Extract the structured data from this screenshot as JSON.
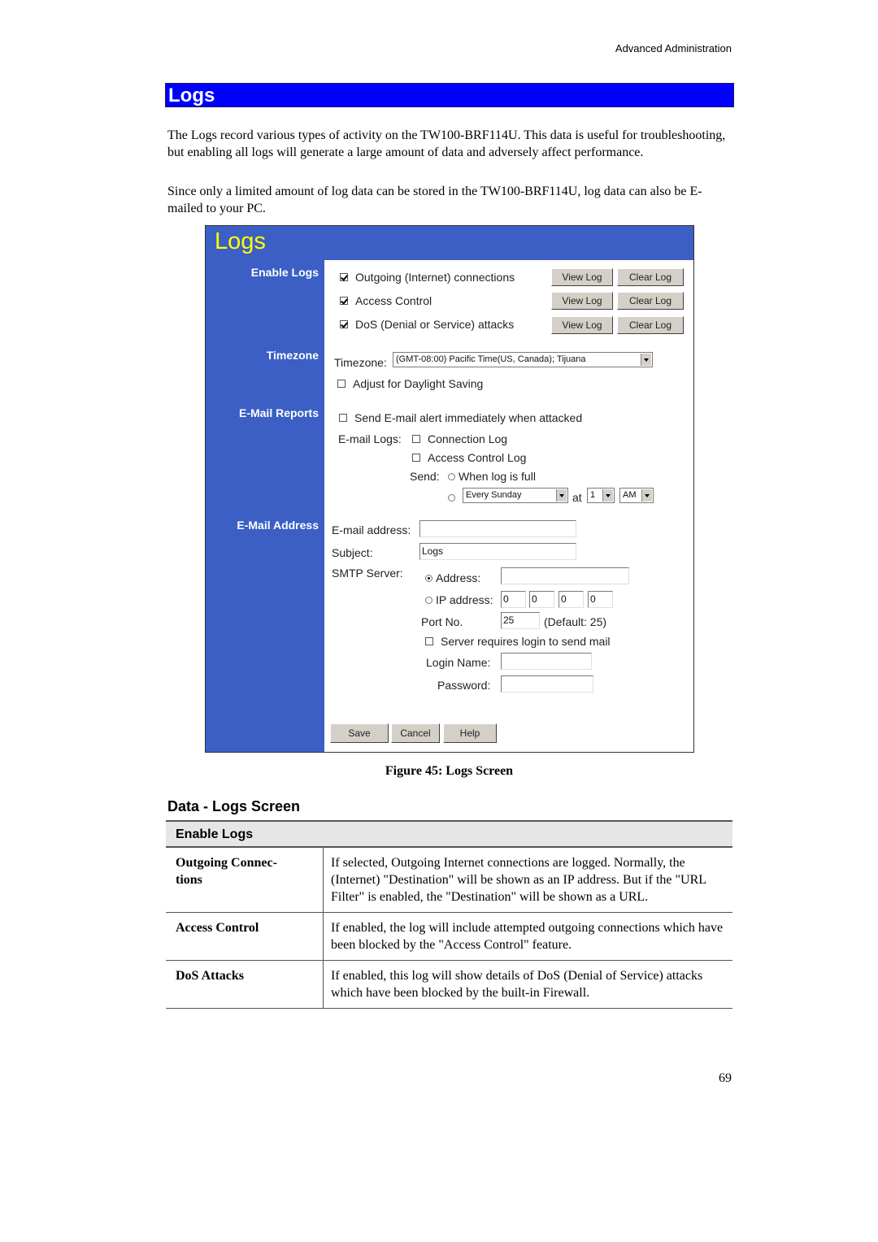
{
  "header": {
    "running_title": "Advanced Administration"
  },
  "section": {
    "title": "Logs"
  },
  "intro": {
    "paragraph1": "The Logs record various types of activity on the TW100-BRF114U. This data is useful for troubleshooting, but enabling all logs will generate a large amount of data and adversely affect performance.",
    "paragraph2": "Since only a limited amount of log data can be stored in the TW100-BRF114U, log data can also be E-mailed to your PC."
  },
  "figure": {
    "title": "Logs",
    "colors": {
      "sidebar": "#3b5fc4",
      "title": "#ffff00",
      "section_bar": "#0000ff"
    },
    "side_labels": {
      "enable_logs": "Enable Logs",
      "timezone": "Timezone",
      "email_reports": "E-Mail Reports",
      "email_address": "E-Mail Address"
    },
    "enable_logs": [
      {
        "label": "Outgoing (Internet) connections",
        "checked": true,
        "view": "View Log",
        "clear": "Clear Log"
      },
      {
        "label": "Access Control",
        "checked": true,
        "view": "View Log",
        "clear": "Clear Log"
      },
      {
        "label": "DoS (Denial or Service) attacks",
        "checked": true,
        "view": "View Log",
        "clear": "Clear Log"
      }
    ],
    "timezone": {
      "label": "Timezone:",
      "value": "(GMT-08:00) Pacific Time(US, Canada); Tijuana",
      "daylight_label": "Adjust for Daylight Saving",
      "daylight_checked": false
    },
    "email_reports": {
      "alert_label": "Send E-mail alert immediately when attacked",
      "email_logs_label": "E-mail Logs:",
      "connection_log": "Connection Log",
      "access_control_log": "Access Control Log",
      "send_label": "Send:",
      "when_full": "When log is full",
      "schedule_day": "Every Sunday",
      "at_label": "at",
      "schedule_hour": "1",
      "schedule_ampm": "AM"
    },
    "email_address": {
      "email_label": "E-mail address:",
      "email_value": "",
      "subject_label": "Subject:",
      "subject_value": "Logs",
      "smtp_label": "SMTP Server:",
      "address_radio": "Address:",
      "address_value": "",
      "ip_radio": "IP address:",
      "ip": [
        "0",
        "0",
        "0",
        "0"
      ],
      "port_label": "Port No.",
      "port_value": "25",
      "port_default": "(Default: 25)",
      "login_required": "Server requires login to send mail",
      "login_name_label": "Login Name:",
      "password_label": "Password:"
    },
    "buttons": {
      "save": "Save",
      "cancel": "Cancel",
      "help": "Help"
    }
  },
  "caption": "Figure 45: Logs Screen",
  "data_section": {
    "title": "Data - Logs Screen",
    "table_header": "Enable Logs",
    "rows": [
      {
        "key": "Outgoing Connec- tions",
        "value": "If selected, Outgoing Internet connections are logged. Normally, the (Internet) \"Destination\" will be shown as an IP address. But if the \"URL Filter\" is enabled, the \"Destination\" will be shown as a URL."
      },
      {
        "key": "Access Control",
        "value": "If enabled, the log will include attempted outgoing connections which have been blocked by the \"Access Control\" feature."
      },
      {
        "key": "DoS Attacks",
        "value": "If enabled, this log will show details of DoS (Denial of Service) attacks which have been blocked by the built-in Firewall."
      }
    ]
  },
  "page_number": "69"
}
